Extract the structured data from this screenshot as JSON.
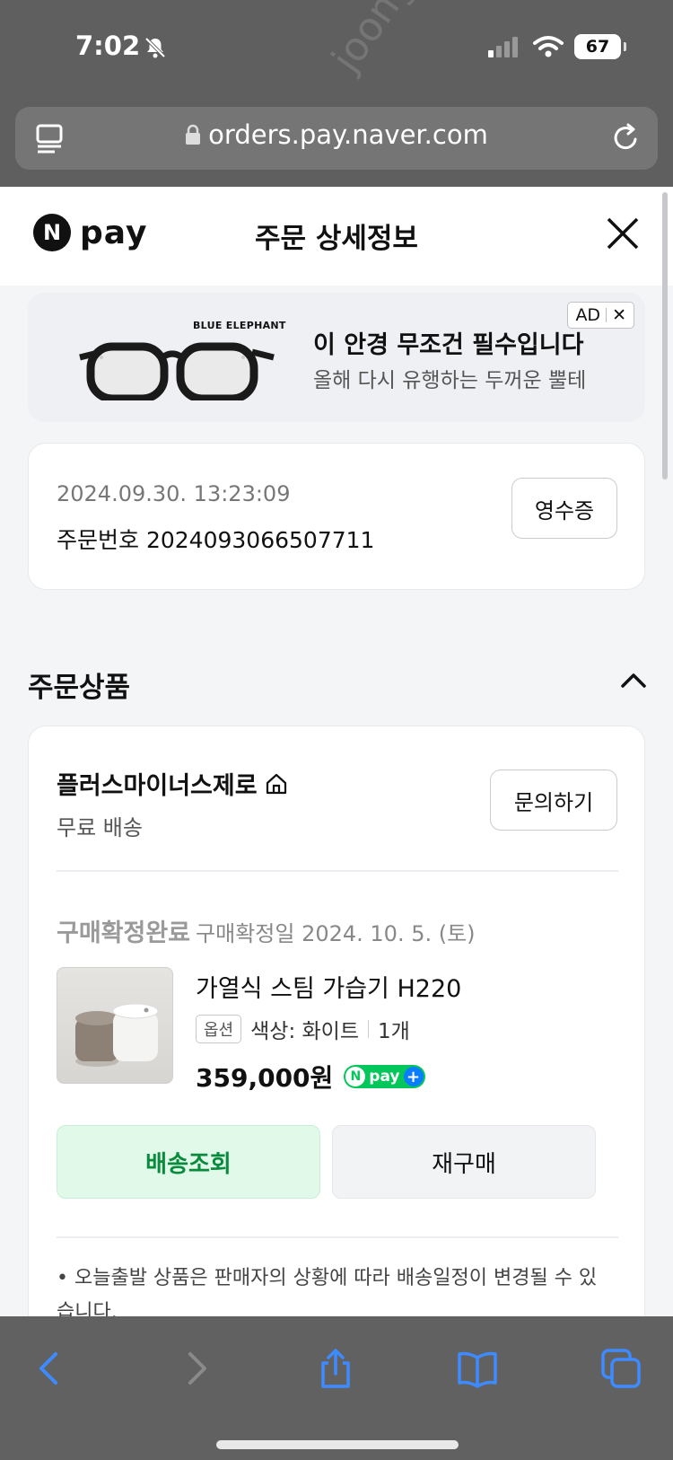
{
  "status_bar": {
    "time": "7:02",
    "battery": "67"
  },
  "browser": {
    "url": "orders.pay.naver.com"
  },
  "header": {
    "logo_letter": "N",
    "logo_text": "pay",
    "title": "주문 상세정보"
  },
  "ad": {
    "brand": "BLUE ELEPHANT",
    "title": "이 안경 무조건 필수입니다",
    "subtitle": "올해 다시 유행하는 두꺼운 뿔테",
    "badge": "AD",
    "badge_close": "✕"
  },
  "order": {
    "datetime": "2024.09.30. 13:23:09",
    "number": "주문번호 2024093066507711",
    "receipt_label": "영수증"
  },
  "section": {
    "title": "주문상품"
  },
  "product_card": {
    "seller": "플러스마이너스제로",
    "shipping": "무료 배송",
    "inquiry_label": "문의하기",
    "status": "구매확정완료",
    "confirm_date": "구매확정일 2024. 10. 5. (토)",
    "product_name": "가열식 스팀 가습기 H220",
    "option_tag": "옵션",
    "option_value": "색상: 화이트",
    "quantity": "1개",
    "price": "359,000원",
    "npay_badge_n": "N",
    "npay_badge_text": "pay",
    "npay_badge_plus": "+",
    "track_label": "배송조회",
    "rebuy_label": "재구매",
    "notice": "• 오늘출발 상품은 판매자의 상황에 따라 배송일정이 변경될 수 있습니다."
  },
  "colors": {
    "accent_green": "#03c75a",
    "track_bg": "#e0f9e9",
    "track_text": "#0a8a3c"
  }
}
